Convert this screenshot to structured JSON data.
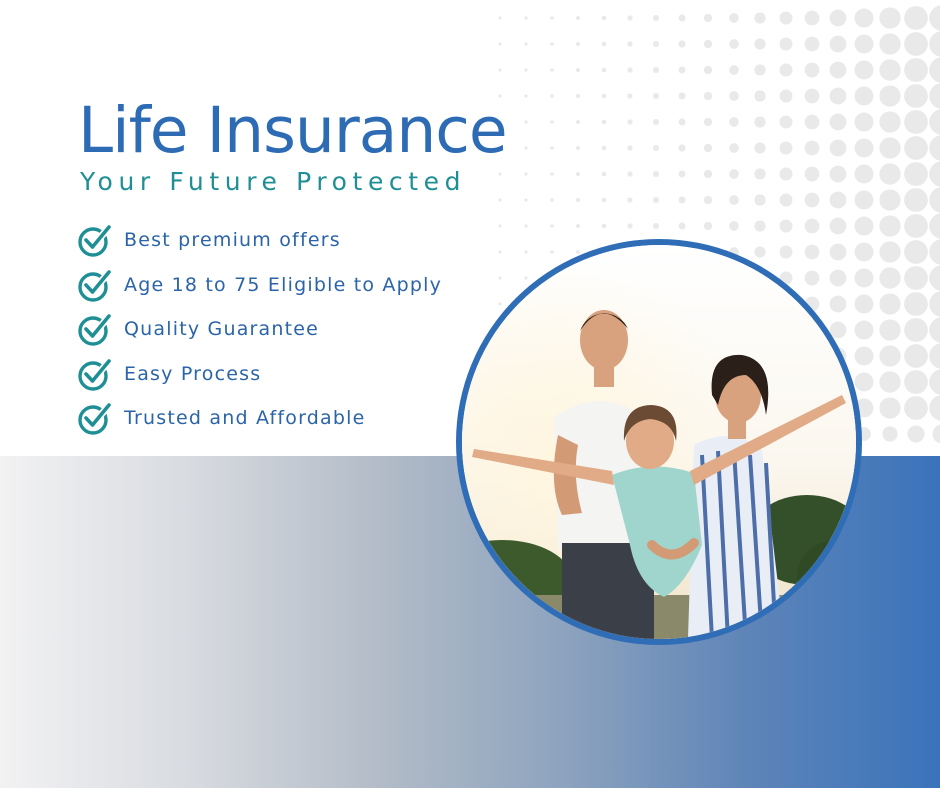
{
  "title": "Life Insurance",
  "subtitle": "Your Future Protected",
  "features": [
    {
      "label": "Best premium offers",
      "icon": "check-circle-icon"
    },
    {
      "label": "Age 18 to 75 Eligible to Apply",
      "icon": "check-circle-icon"
    },
    {
      "label": "Quality Guarantee",
      "icon": "check-circle-icon"
    },
    {
      "label": "Easy Process",
      "icon": "check-circle-icon"
    },
    {
      "label": "Trusted and Affordable",
      "icon": "check-circle-icon"
    }
  ],
  "photo": {
    "subject": "family-photo"
  },
  "colors": {
    "title": "#2d6cb5",
    "subtitle": "#1f8f96",
    "check": "#1f8f96",
    "feature_text": "#2b64a8",
    "photo_ring": "#2f6db6",
    "band_left": "#f2f2f3",
    "band_right": "#3a73bb"
  }
}
